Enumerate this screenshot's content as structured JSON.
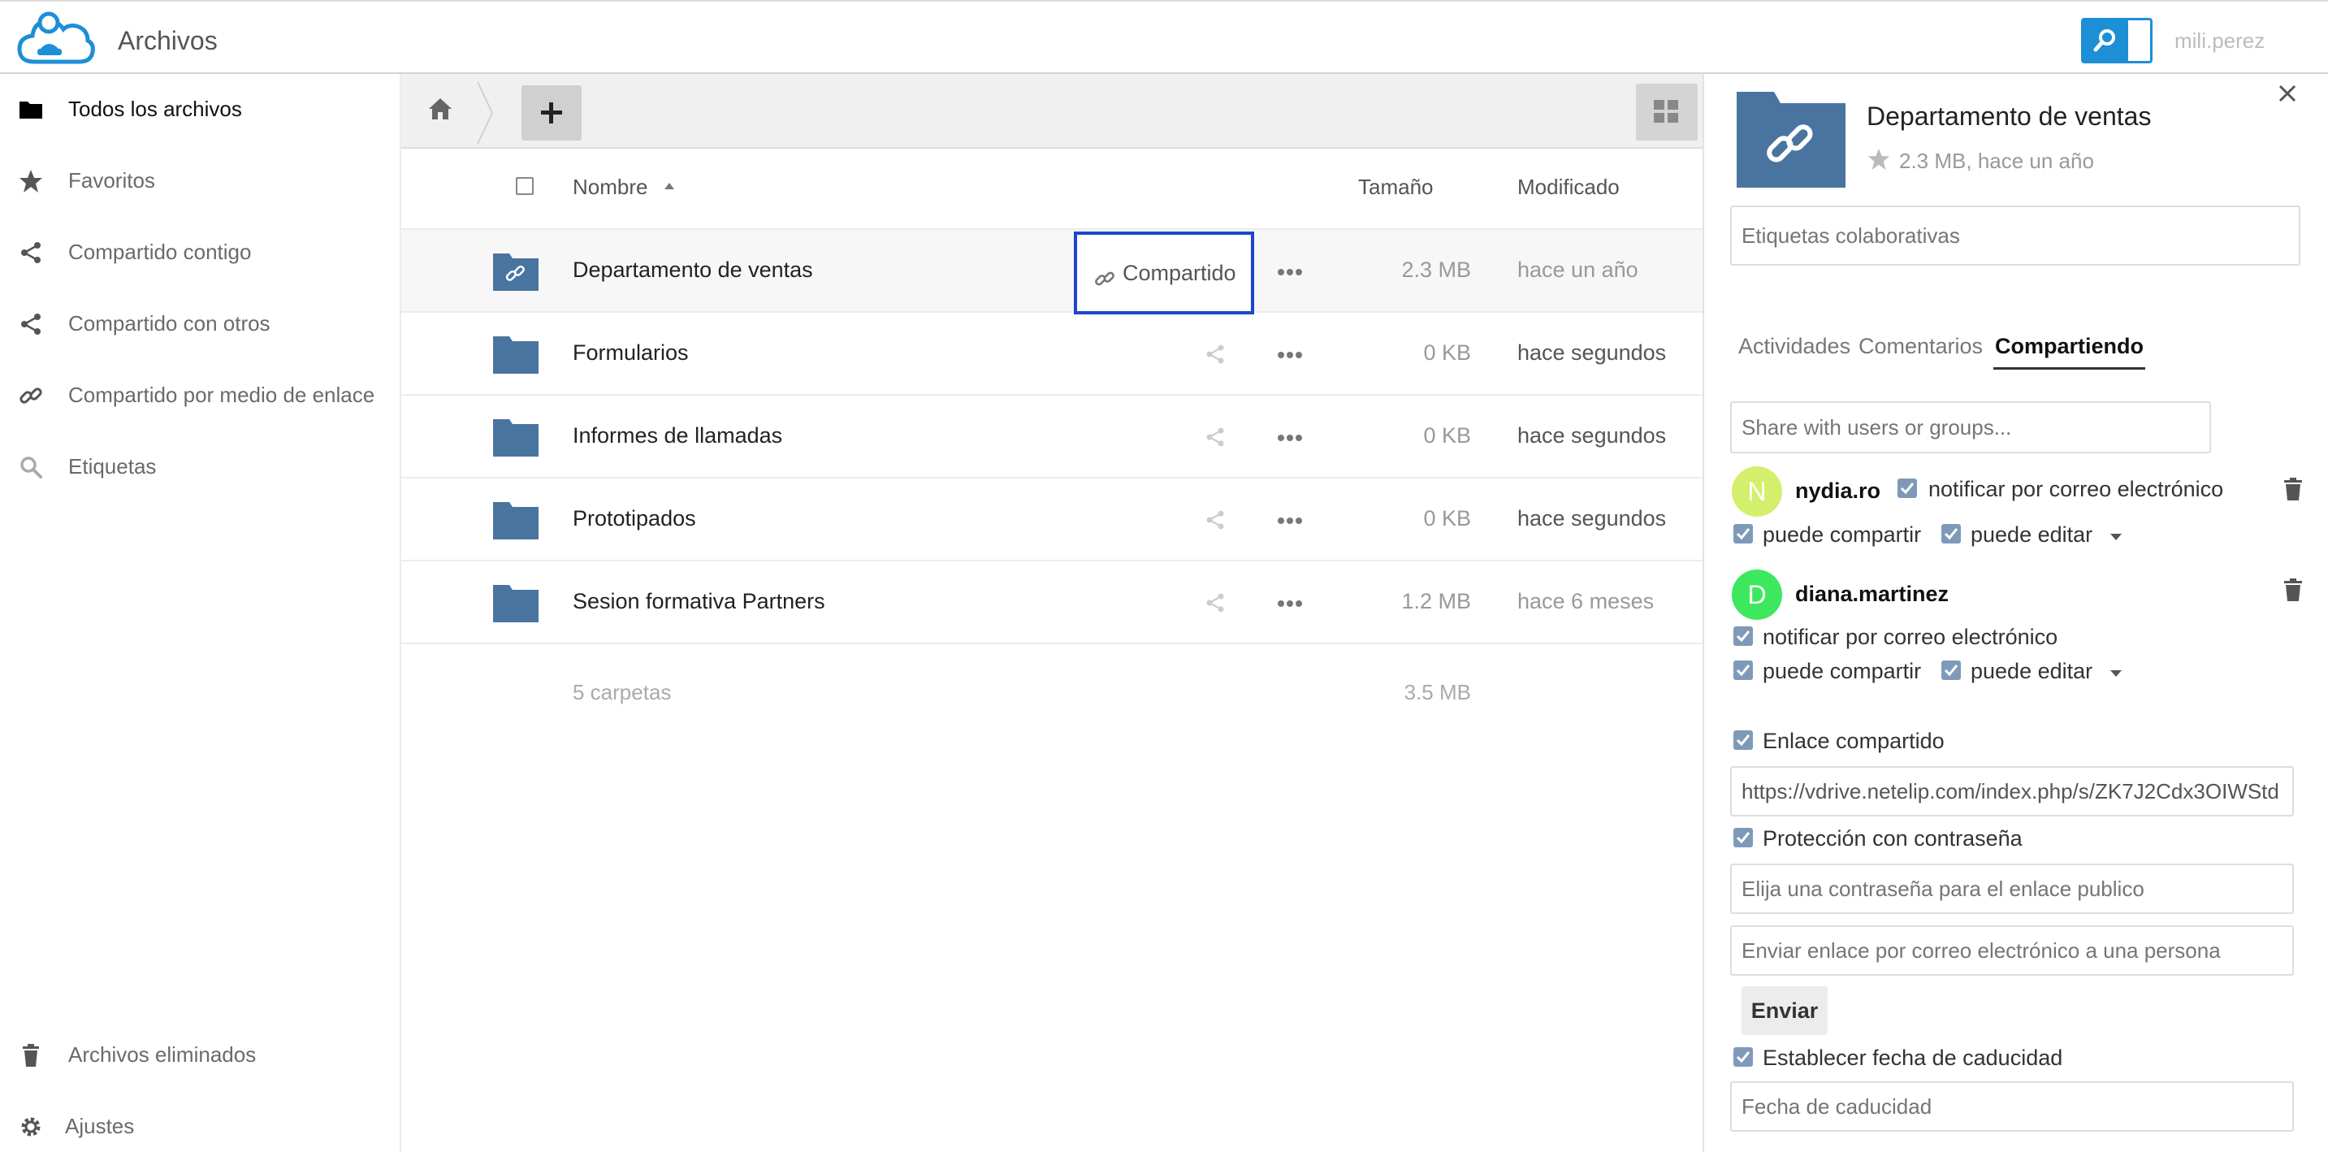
{
  "header": {
    "app_title": "Archivos",
    "user": "mili.perez"
  },
  "sidebar": {
    "items": [
      {
        "label": "Todos los archivos",
        "icon": "folder-icon"
      },
      {
        "label": "Favoritos",
        "icon": "star-icon"
      },
      {
        "label": "Compartido contigo",
        "icon": "share-icon"
      },
      {
        "label": "Compartido con otros",
        "icon": "share-icon"
      },
      {
        "label": "Compartido por medio de enlace",
        "icon": "link-icon"
      },
      {
        "label": "Etiquetas",
        "icon": "tag-search-icon"
      }
    ],
    "bottom": [
      {
        "label": "Archivos eliminados",
        "icon": "trash-icon"
      },
      {
        "label": "Ajustes",
        "icon": "gear-icon"
      }
    ]
  },
  "files": {
    "columns": {
      "name": "Nombre",
      "size": "Tamaño",
      "modified": "Modificado"
    },
    "rows": [
      {
        "name": "Departamento de ventas",
        "size": "2.3 MB",
        "modified": "hace un año",
        "shared_label": "Compartido"
      },
      {
        "name": "Formularios",
        "size": "0 KB",
        "modified": "hace segundos"
      },
      {
        "name": "Informes de llamadas",
        "size": "0 KB",
        "modified": "hace segundos"
      },
      {
        "name": "Prototipados",
        "size": "0 KB",
        "modified": "hace segundos"
      },
      {
        "name": "Sesion formativa Partners",
        "size": "1.2 MB",
        "modified": "hace 6 meses"
      }
    ],
    "summary": {
      "count": "5 carpetas",
      "size": "3.5 MB"
    }
  },
  "panel": {
    "title": "Departamento de ventas",
    "meta": "2.3 MB, hace un año",
    "tags_placeholder": "Etiquetas colaborativas",
    "tabs": [
      "Actividades",
      "Comentarios",
      "Compartiendo"
    ],
    "share_placeholder": "Share with users or groups...",
    "shares": [
      {
        "initial": "N",
        "user": "nydia.ro",
        "notify": "notificar por correo electrónico",
        "can_share": "puede compartir",
        "can_edit": "puede editar",
        "color": "#d4ef6b"
      },
      {
        "initial": "D",
        "user": "diana.martinez",
        "notify": "notificar por correo electrónico",
        "can_share": "puede compartir",
        "can_edit": "puede editar",
        "color": "#3ee85e"
      }
    ],
    "link_share_label": "Enlace compartido",
    "link_url": "https://vdrive.netelip.com/index.php/s/ZK7J2Cdx3OIWStd",
    "password_label": "Protección con contraseña",
    "password_placeholder": "Elija una contraseña para el enlace publico",
    "email_placeholder": "Enviar enlace por correo electrónico a una persona",
    "send_label": "Enviar",
    "expiry_label": "Establecer fecha de caducidad",
    "expiry_placeholder": "Fecha de caducidad"
  },
  "colors": {
    "accent": "#1d8fd6",
    "folder": "#4a74a0",
    "highlight": "#1c46cc",
    "checkbox": "#7f9ab8"
  }
}
